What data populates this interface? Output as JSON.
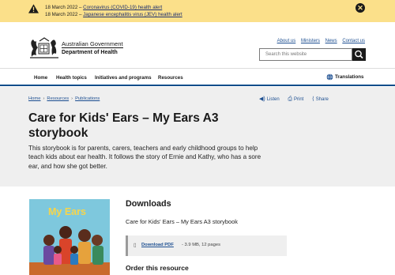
{
  "alert": {
    "lines": [
      {
        "date": "18 March 2022 – ",
        "link": "Coronavirus (COVID-19) health alert"
      },
      {
        "date": "18 March 2022 – ",
        "link": "Japanese encephalitis virus (JEV) health alert"
      }
    ],
    "close_glyph": "✕"
  },
  "header": {
    "gov_line1": "Australian Government",
    "gov_line2": "Department of Health",
    "top_links": [
      "About us",
      "Ministers",
      "News",
      "Contact us"
    ],
    "search_placeholder": "Search this website"
  },
  "nav": {
    "items": [
      "Home",
      "Health topics",
      "Initiatives and programs",
      "Resources"
    ],
    "translations": "Translations"
  },
  "hero": {
    "breadcrumbs": [
      "Home",
      "Resources",
      "Publications"
    ],
    "actions": [
      {
        "icon": "listen-icon",
        "label": "Listen"
      },
      {
        "icon": "print-icon",
        "label": "Print"
      },
      {
        "icon": "share-icon",
        "label": "Share"
      }
    ],
    "title": "Care for Kids' Ears – My Ears A3 storybook",
    "intro": "This storybook is for parents, carers, teachers and early childhood groups to help teach kids about ear health. It follows the story of Ernie and Kathy, who has a sore ear, and how she got better."
  },
  "content": {
    "cover_title": "My Ears",
    "downloads_heading": "Downloads",
    "document_name": "Care for Kids' Ears – My Ears A3 storybook",
    "download_link": "Download PDF",
    "download_meta": " - 3.9 MB, 12 pages",
    "order_heading": "Order this resource"
  },
  "colors": {
    "alert_bg": "#fbe08a",
    "nav_rule": "#0d4d8a",
    "link": "#1d4f91",
    "hero_bg": "#efefef"
  }
}
